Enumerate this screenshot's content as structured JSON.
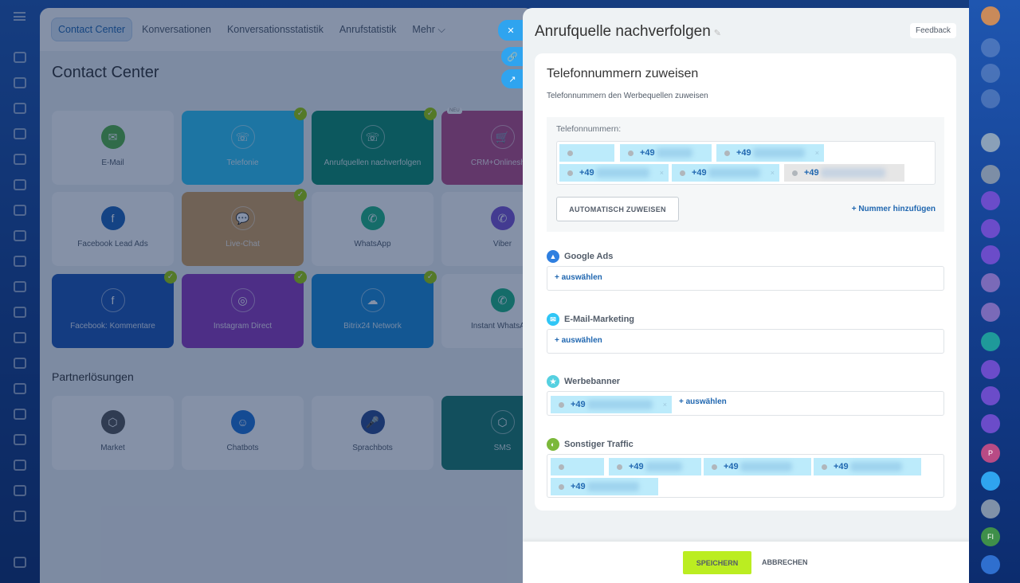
{
  "main": {
    "nav": [
      "Contact Center",
      "Konversationen",
      "Konversationsstatistik",
      "Anrufstatistik",
      "Mehr ⌵"
    ],
    "title": "Contact Center",
    "tiles": [
      {
        "label": "E-Mail",
        "color": "#ffffff",
        "icon": "✉",
        "iconBg": "#55b342",
        "checked": false
      },
      {
        "label": "Telefonie",
        "color": "#2fc6f6",
        "icon": "☏",
        "checked": true
      },
      {
        "label": "Anrufquellen nachverfolgen",
        "color": "#0d8c6c",
        "icon": "☏",
        "checked": true
      },
      {
        "label": "CRM+Onlineshop",
        "color": "#b84b85",
        "icon": "🛒",
        "checked": false,
        "badge": "NEU"
      },
      {
        "label": "Facebook Lead Ads",
        "color": "#ffffff",
        "icon": "f",
        "iconBg": "#1d62b8",
        "checked": false
      },
      {
        "label": "Live-Chat",
        "color": "#d4a05c",
        "icon": "💬",
        "checked": true
      },
      {
        "label": "WhatsApp",
        "color": "#ffffff",
        "icon": "✆",
        "iconBg": "#1fb583",
        "checked": false
      },
      {
        "label": "Viber",
        "color": "#ffffff",
        "icon": "✆",
        "iconBg": "#7b52d3",
        "checked": false
      },
      {
        "label": "Facebook: Kommentare",
        "color": "#1d55b3",
        "icon": "f",
        "checked": true
      },
      {
        "label": "Instagram Direct",
        "color": "#8e39bd",
        "icon": "◎",
        "checked": true
      },
      {
        "label": "Bitrix24 Network",
        "color": "#1b8ad6",
        "icon": "☁",
        "checked": true
      },
      {
        "label": "Instant WhatsApp",
        "color": "#ffffff",
        "icon": "✆",
        "iconBg": "#1fb583",
        "checked": false
      }
    ],
    "partner_title": "Partnerlösungen",
    "partners": [
      {
        "label": "Market",
        "color": "#ffffff",
        "icon": "⬡",
        "iconBg": "#555"
      },
      {
        "label": "Chatbots",
        "color": "#ffffff",
        "icon": "☺",
        "iconBg": "#1d73d6"
      },
      {
        "label": "Sprachbots",
        "color": "#ffffff",
        "icon": "🎤",
        "iconBg": "#2b4a8f"
      },
      {
        "label": "SMS",
        "color": "#187a6a",
        "icon": "⬡"
      }
    ]
  },
  "side_buttons": {
    "close": "✕",
    "link": "🔗",
    "open": "↗"
  },
  "panel": {
    "title": "Anrufquelle nachverfolgen",
    "feedback": "Feedback",
    "card_title": "Telefonnummern zuweisen",
    "card_subtitle": "Telefonnummern den Werbequellen zuweisen",
    "phones_label": "Telefonnummern:",
    "phones": [
      "",
      "+49",
      "+49",
      "+49",
      "+49",
      "+49"
    ],
    "auto_assign": "AUTOMATISCH ZUWEISEN",
    "add_number": "+ Nummer hinzufügen",
    "choose": "+  auswählen",
    "sources": [
      {
        "name": "Google Ads",
        "color": "#2e7fe0",
        "icon": "▲",
        "numbers": []
      },
      {
        "name": "E-Mail-Marketing",
        "color": "#2fc6f6",
        "icon": "✉",
        "numbers": []
      },
      {
        "name": "Werbebanner",
        "color": "#55d0e0",
        "icon": "★",
        "numbers": [
          "+49"
        ]
      },
      {
        "name": "Sonstiger Traffic",
        "color": "#7bb83a",
        "icon": "◐",
        "numbers": [
          "",
          "+49",
          "+49",
          "+49",
          "+49"
        ]
      }
    ],
    "save": "SPEICHERN",
    "cancel": "ABBRECHEN"
  },
  "rightbar": {
    "initials_p": "P",
    "initials_fi": "FI"
  }
}
